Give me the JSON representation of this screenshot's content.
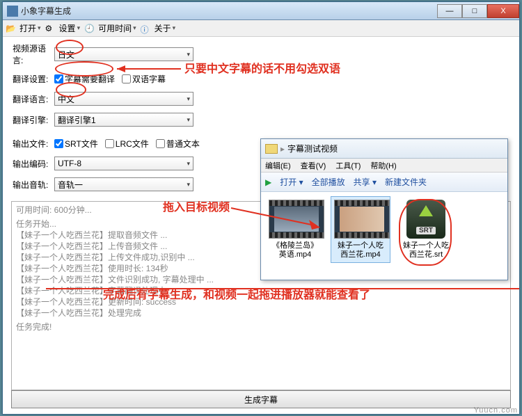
{
  "titlebar": {
    "title": "小象字幕生成"
  },
  "menu": {
    "open": "打开",
    "settings": "设置",
    "time": "可用时间",
    "about": "关于"
  },
  "form": {
    "srcLangLabel": "视频源语言:",
    "srcLang": "日文",
    "transSetLabel": "翻译设置:",
    "needTrans": "字幕需要翻译",
    "bilingual": "双语字幕",
    "transLangLabel": "翻译语言:",
    "transLang": "中文",
    "engineLabel": "翻译引擎:",
    "engine": "翻译引擎1",
    "outFileLabel": "输出文件:",
    "srt": "SRT文件",
    "lrc": "LRC文件",
    "plain": "普通文本",
    "encLabel": "输出编码:",
    "enc": "UTF-8",
    "trackLabel": "输出音轨:",
    "track": "音轨一"
  },
  "log": {
    "header": "可用时间: 600分钟...",
    "start": "任务开始...",
    "lines": [
      "【妹子一个人吃西兰花】提取音频文件 ...",
      "【妹子一个人吃西兰花】上传音频文件 ...",
      "【妹子一个人吃西兰花】上传文件成功,识别中 ...",
      "【妹子一个人吃西兰花】使用时长: 134秒",
      "【妹子一个人吃西兰花】文件识别成功, 字幕处理中 ...",
      "【妹子一个人吃西兰花】字幕翻译处理中 ...",
      "【妹子一个人吃西兰花】更新时间: success",
      "【妹子一个人吃西兰花】处理完成"
    ],
    "done": "任务完成!"
  },
  "generate": "生成字幕",
  "explorer": {
    "path": "字幕测试视频",
    "menus": {
      "edit": "编辑(E)",
      "view": "查看(V)",
      "tools": "工具(T)",
      "help": "帮助(H)"
    },
    "tb": {
      "open": "打开",
      "playall": "全部播放",
      "share": "共享",
      "newfolder": "新建文件夹"
    },
    "files": [
      {
        "name": "《格陵兰岛》英语.mp4"
      },
      {
        "name": "妹子一个人吃西兰花.mp4"
      },
      {
        "name": "妹子一个人吃西兰花.srt"
      }
    ]
  },
  "annot": {
    "a1": "只要中文字幕的话不用勾选双语",
    "a2": "拖入目标视频",
    "a3": "完成后有字幕生成，和视频一起拖进播放器就能查看了"
  },
  "watermark": "Yuucn.com"
}
